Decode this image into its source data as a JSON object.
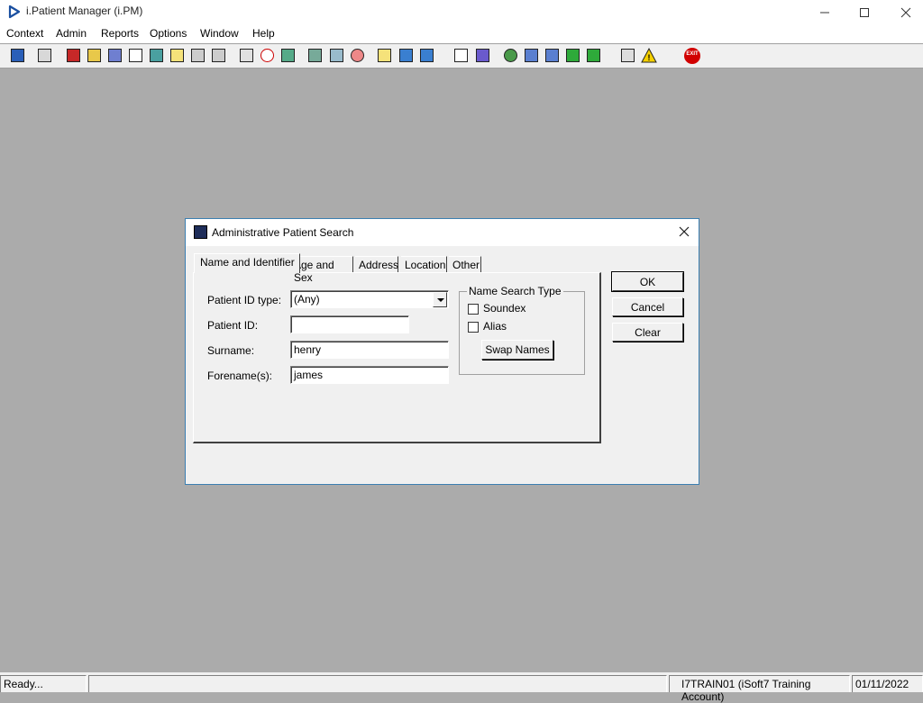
{
  "window": {
    "title": "i.Patient Manager (i.PM)"
  },
  "menu": {
    "items": [
      "Context",
      "Admin",
      "Reports",
      "Options",
      "Window",
      "Help"
    ]
  },
  "toolbar": {
    "exit_label": "EXIT",
    "icons": [
      "patient-icon",
      "printer-icon",
      "book-icon",
      "edit-icon",
      "list-icon",
      "m-icon",
      "doctor-icon",
      "notes-icon",
      "ambulance-icon",
      "ambulance2-icon",
      "search-doc-icon",
      "clock-icon",
      "monitor-icon",
      "image-icon",
      "chat-icon",
      "dial-icon",
      "form-icon",
      "bed-icon",
      "bed2-icon",
      "page-icon",
      "chart-icon",
      "globe-icon",
      "inbox-icon",
      "inbox2-icon",
      "download-icon",
      "download2-icon",
      "transfer-icon",
      "warning-icon",
      "exit-icon"
    ]
  },
  "dialog": {
    "title": "Administrative Patient Search",
    "tabs": [
      "Name and Identifier",
      "Age and Sex",
      "Address",
      "Location",
      "Other"
    ],
    "fields": {
      "id_type_label": "Patient ID type:",
      "id_type_value": "(Any)",
      "patient_id_label": "Patient ID:",
      "patient_id_value": "",
      "surname_label": "Surname:",
      "surname_value": "henry",
      "forename_label": "Forename(s):",
      "forename_value": "james"
    },
    "name_search": {
      "title": "Name Search Type",
      "soundex_label": "Soundex",
      "soundex_checked": false,
      "alias_label": "Alias",
      "alias_checked": false,
      "swap_label": "Swap Names"
    },
    "buttons": {
      "ok": "OK",
      "cancel": "Cancel",
      "clear": "Clear"
    }
  },
  "status": {
    "message": "Ready...",
    "account": "I7TRAIN01 (iSoft7 Training Account)",
    "date": "01/11/2022"
  }
}
